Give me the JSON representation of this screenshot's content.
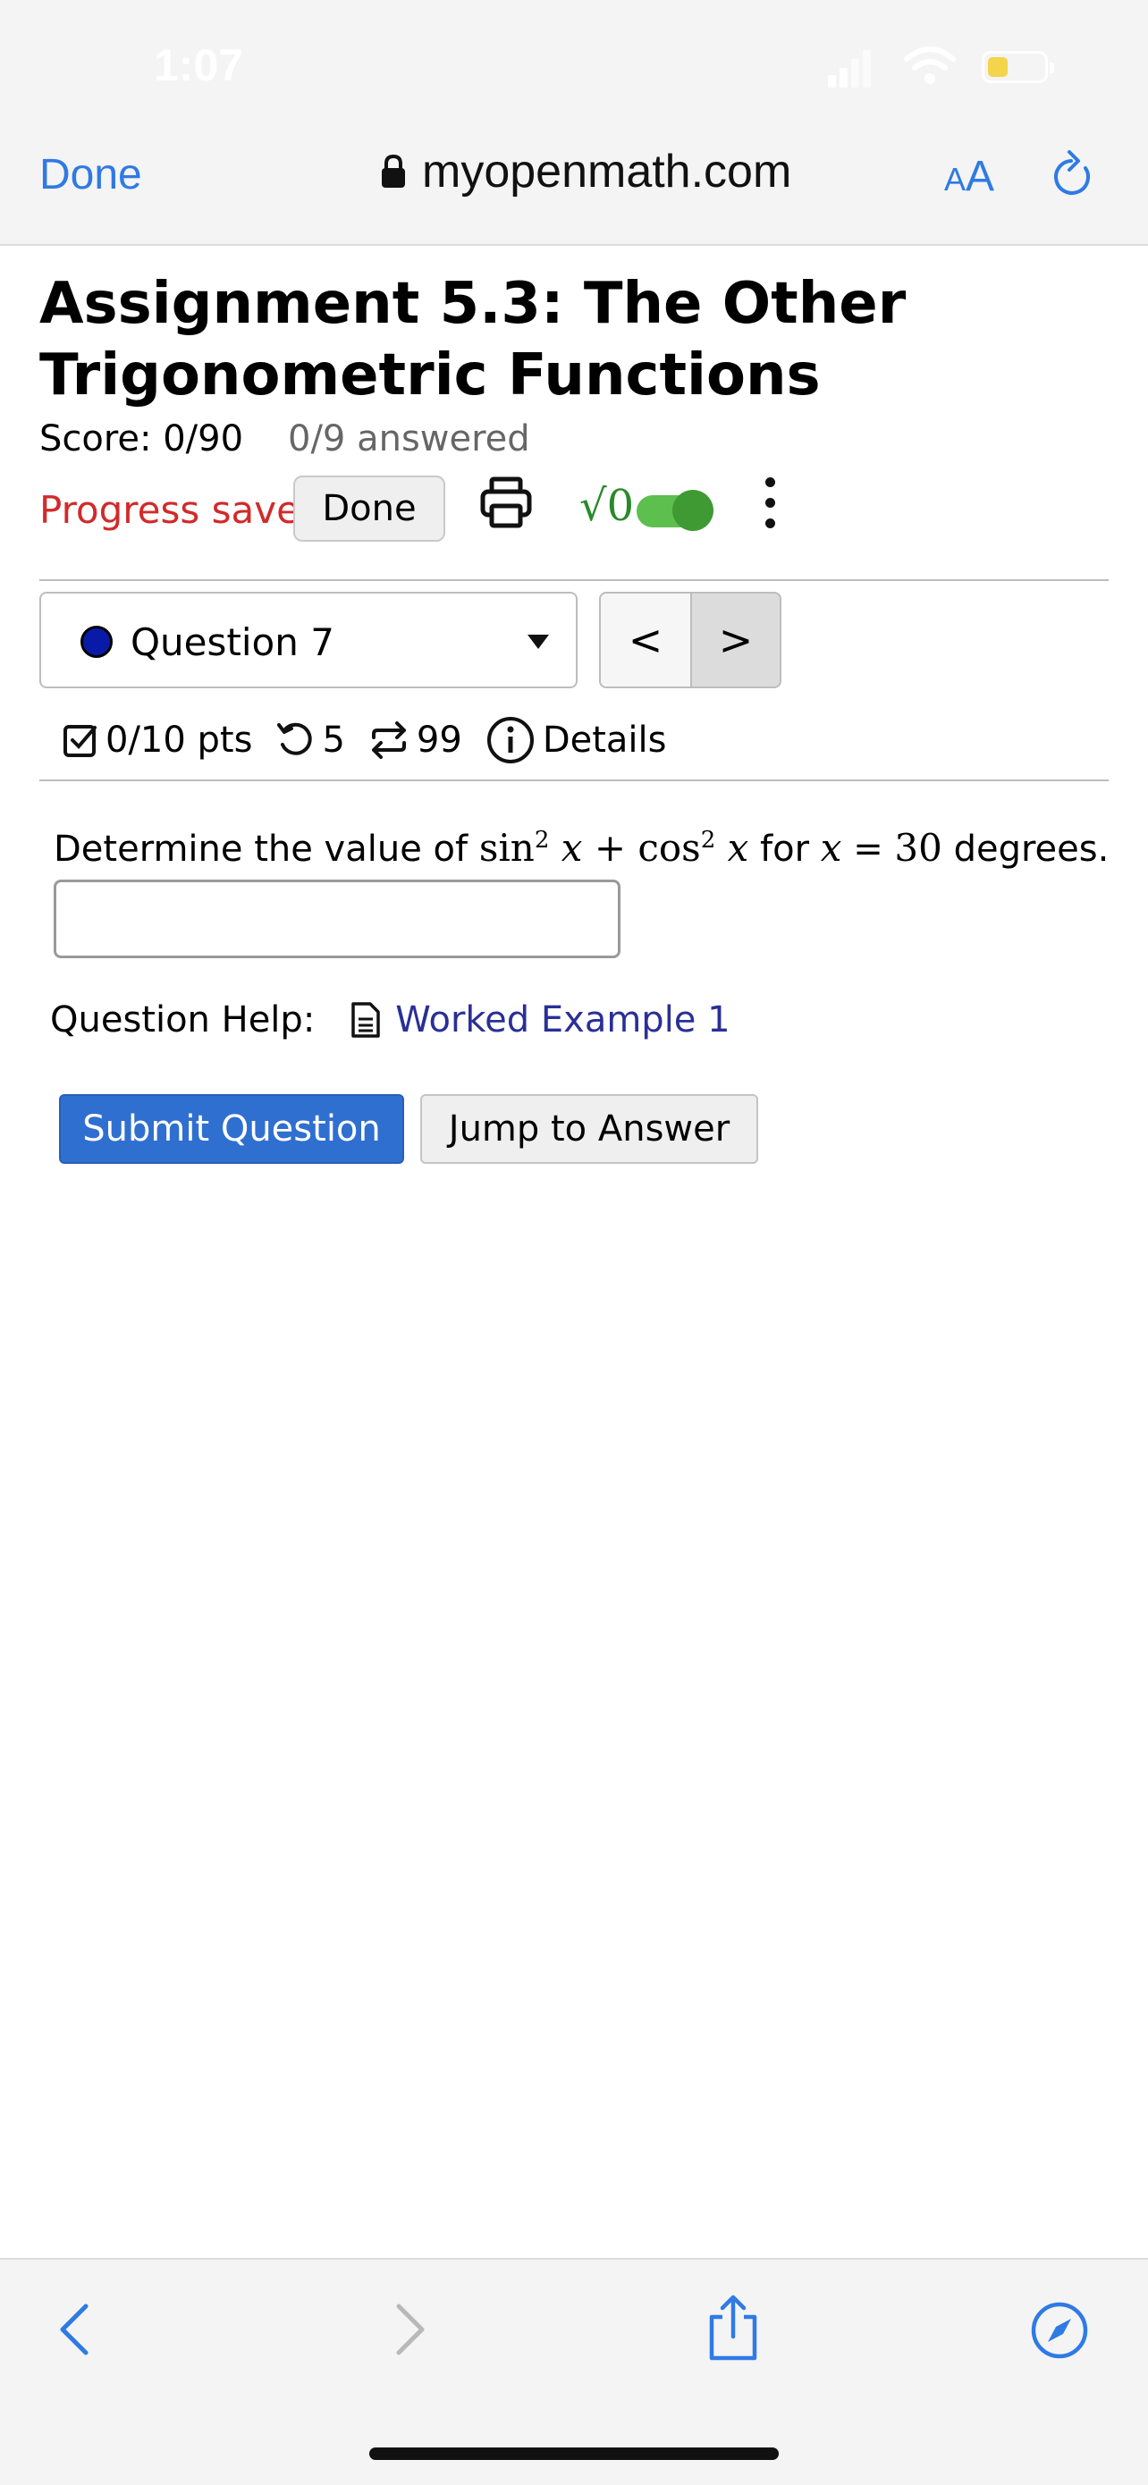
{
  "status_bar": {
    "time": "1:07"
  },
  "browser": {
    "done_label": "Done",
    "url": "myopenmath.com",
    "text_size_label_small": "A",
    "text_size_label_large": "A",
    "accent_color": "#2f7ae5"
  },
  "assignment": {
    "title": "Assignment 5.3: The Other Trigonometric Functions",
    "score": "Score: 0/90",
    "answered": "0/9 answered",
    "progress_status": "Progress saved",
    "done_button": "Done",
    "math_display_symbol": "√0",
    "math_toggle_on": true
  },
  "question_nav": {
    "selected_question": "Question 7",
    "prev_label": "<",
    "next_label": ">"
  },
  "question_stats": {
    "points": "0/10 pts",
    "retries": "5",
    "versions": "99",
    "details_label": "Details"
  },
  "question": {
    "text_prefix": "Determine the value of ",
    "sin": "sin",
    "cos": "cos",
    "exp": "2",
    "var": "x",
    "plus": "+",
    "text_mid": " for ",
    "equals": "=",
    "value": "30",
    "text_suffix": " degrees.",
    "answer_value": ""
  },
  "help": {
    "label": "Question Help:",
    "link": "Worked Example 1",
    "link_color": "#2a2f96"
  },
  "actions": {
    "submit_label": "Submit Question",
    "jump_label": "Jump to Answer",
    "submit_color": "#2f6fd0"
  },
  "progress_color": "#d22a2a"
}
